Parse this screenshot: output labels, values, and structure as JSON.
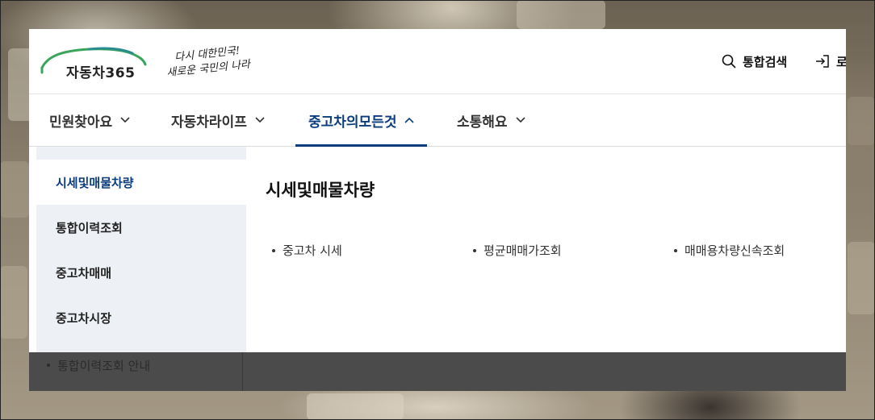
{
  "header": {
    "logo_text": "자동차365",
    "slogan_line1": "다시 대한민국!",
    "slogan_line2": "새로운 국민의 나라",
    "search_label": "통합검색",
    "login_label": "로"
  },
  "gnb": {
    "items": [
      {
        "label": "민원찾아요",
        "icon": "chevron-down-icon"
      },
      {
        "label": "자동차라이프",
        "icon": "chevron-down-icon"
      },
      {
        "label": "중고차의모든것",
        "icon": "chevron-up-icon"
      },
      {
        "label": "소통해요",
        "icon": "chevron-down-icon"
      }
    ],
    "active_index": 2
  },
  "side_menu": {
    "items": [
      {
        "label": "시세및매물차량"
      },
      {
        "label": "통합이력조회"
      },
      {
        "label": "중고차매매"
      },
      {
        "label": "중고차시장"
      }
    ],
    "active_index": 0
  },
  "content": {
    "title": "시세및매물차량",
    "links": [
      {
        "label": "중고차 시세"
      },
      {
        "label": "평균매매가조회"
      },
      {
        "label": "매매용차량신속조회"
      }
    ]
  },
  "dark_bar": {
    "item_label": "통합이력조회 안내"
  },
  "colors": {
    "accent": "#0b3c7c",
    "logo_green": "#3aa55a",
    "logo_teal": "#2a8c8c",
    "side_bg": "#edf0f4",
    "dark_bar": "#4b4b4b"
  }
}
